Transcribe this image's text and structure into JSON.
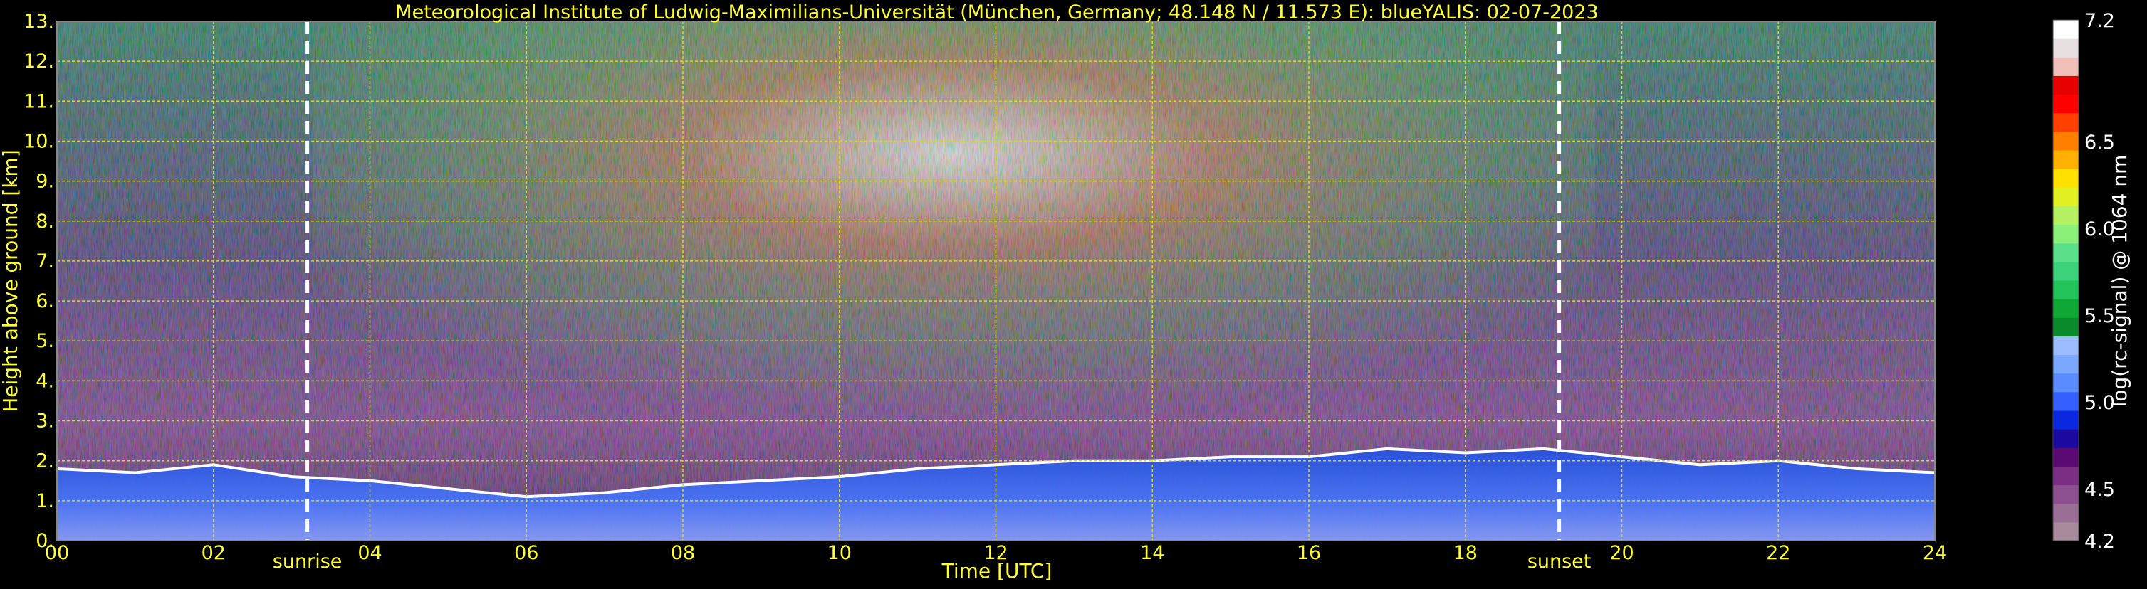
{
  "chart_data": {
    "type": "heatmap",
    "title": "Meteorological Institute of Ludwig-Maximilians-Universität (München, Germany; 48.148 N / 11.573 E):    blueYALIS: 02-07-2023",
    "xlabel": "Time [UTC]",
    "ylabel": "Height above ground [km]",
    "xlim": [
      0,
      24
    ],
    "ylim": [
      0,
      13
    ],
    "x_ticks": [
      0,
      2,
      4,
      6,
      8,
      10,
      12,
      14,
      16,
      18,
      20,
      22,
      24
    ],
    "x_tick_labels": [
      "00",
      "02",
      "04",
      "06",
      "08",
      "10",
      "12",
      "14",
      "16",
      "18",
      "20",
      "22",
      "24"
    ],
    "y_ticks": [
      0,
      1,
      2,
      3,
      4,
      5,
      6,
      7,
      8,
      9,
      10,
      11,
      12,
      13
    ],
    "y_tick_labels": [
      "0.",
      "1.",
      "2.",
      "3.",
      "4.",
      "5.",
      "6.",
      "7.",
      "8.",
      "9.",
      "10.",
      "11.",
      "12.",
      "13."
    ],
    "grid": true,
    "annotations": [
      {
        "label": "sunrise",
        "time_utc": 3.2
      },
      {
        "label": "sunset",
        "time_utc": 19.2
      }
    ],
    "colorbar": {
      "label": "log(rc-signal) @ 1064 nm",
      "min": 4.2,
      "max": 7.2,
      "ticks": [
        4.2,
        4.5,
        5.0,
        5.5,
        6.0,
        6.5,
        7.2
      ],
      "tick_labels": [
        "4.2",
        "4.5",
        "5.0",
        "5.5",
        "6.0",
        "6.5",
        "7.2"
      ],
      "colors": [
        "#a88a9c",
        "#9a6e95",
        "#8c4f8f",
        "#7a2f85",
        "#5a0a72",
        "#1a0aa0",
        "#0a28e0",
        "#3460ff",
        "#5a8cff",
        "#7aa8ff",
        "#9cbcff",
        "#0a8a2a",
        "#10a835",
        "#22c45a",
        "#3cd27a",
        "#5ae08a",
        "#8af07a",
        "#b4f060",
        "#e0f020",
        "#ffe000",
        "#ffb000",
        "#ff8000",
        "#ff4000",
        "#ff0000",
        "#e60000",
        "#f0c0b8",
        "#e8e0e0",
        "#ffffff"
      ]
    },
    "profile": [
      {
        "time_utc": 0.0,
        "boundary_layer_top_km": 1.8
      },
      {
        "time_utc": 1.0,
        "boundary_layer_top_km": 1.7
      },
      {
        "time_utc": 2.0,
        "boundary_layer_top_km": 1.9
      },
      {
        "time_utc": 3.0,
        "boundary_layer_top_km": 1.6
      },
      {
        "time_utc": 4.0,
        "boundary_layer_top_km": 1.5
      },
      {
        "time_utc": 5.0,
        "boundary_layer_top_km": 1.3
      },
      {
        "time_utc": 6.0,
        "boundary_layer_top_km": 1.1
      },
      {
        "time_utc": 7.0,
        "boundary_layer_top_km": 1.2
      },
      {
        "time_utc": 8.0,
        "boundary_layer_top_km": 1.4
      },
      {
        "time_utc": 9.0,
        "boundary_layer_top_km": 1.5
      },
      {
        "time_utc": 10.0,
        "boundary_layer_top_km": 1.6
      },
      {
        "time_utc": 11.0,
        "boundary_layer_top_km": 1.8
      },
      {
        "time_utc": 12.0,
        "boundary_layer_top_km": 1.9
      },
      {
        "time_utc": 13.0,
        "boundary_layer_top_km": 2.0
      },
      {
        "time_utc": 14.0,
        "boundary_layer_top_km": 2.0
      },
      {
        "time_utc": 15.0,
        "boundary_layer_top_km": 2.1
      },
      {
        "time_utc": 16.0,
        "boundary_layer_top_km": 2.1
      },
      {
        "time_utc": 17.0,
        "boundary_layer_top_km": 2.3
      },
      {
        "time_utc": 18.0,
        "boundary_layer_top_km": 2.2
      },
      {
        "time_utc": 19.0,
        "boundary_layer_top_km": 2.3
      },
      {
        "time_utc": 20.0,
        "boundary_layer_top_km": 2.1
      },
      {
        "time_utc": 21.0,
        "boundary_layer_top_km": 1.9
      },
      {
        "time_utc": 22.0,
        "boundary_layer_top_km": 2.0
      },
      {
        "time_utc": 23.0,
        "boundary_layer_top_km": 1.8
      },
      {
        "time_utc": 24.0,
        "boundary_layer_top_km": 1.7
      }
    ]
  }
}
